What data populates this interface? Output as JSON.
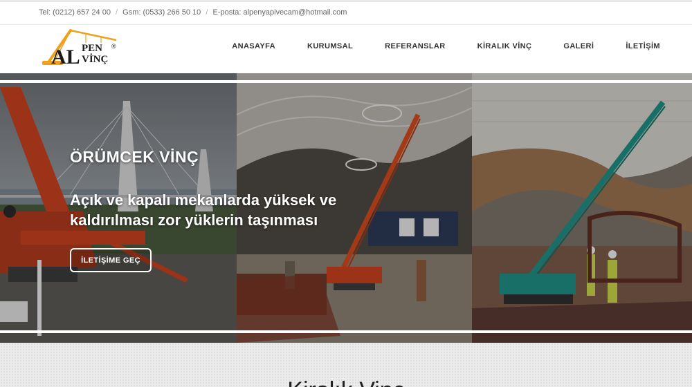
{
  "topbar": {
    "phone": "Tel: (0212) 657 24 00",
    "gsm": "Gsm: (0533) 266 50 10",
    "email": "E-posta: alpenyapivecam@hotmail.com",
    "separator": "/"
  },
  "logo": {
    "text_al": "AL",
    "text_pen": "PEN",
    "text_vinc": "VİNÇ",
    "registered": "®",
    "brand_color": "#f0a11c",
    "text_color": "#1a1a1a"
  },
  "nav": {
    "items": [
      {
        "label": "ANASAYFA"
      },
      {
        "label": "KURUMSAL"
      },
      {
        "label": "REFERANSLAR"
      },
      {
        "label": "KİRALIK VİNÇ"
      },
      {
        "label": "GALERİ"
      },
      {
        "label": "İLETİŞİM"
      }
    ]
  },
  "hero": {
    "title": "ÖRÜMCEK VİNÇ",
    "subtitle": "Açık ve kapalı mekanlarda yüksek ve kaldırılması zor yüklerin taşınması",
    "button_label": "İLETİŞİME GEÇ"
  },
  "section": {
    "title": "Kiralık Vinç"
  },
  "colors": {
    "crane_red": "#c8401f",
    "crane_teal": "#1e8f86",
    "nav_text": "#333333"
  }
}
